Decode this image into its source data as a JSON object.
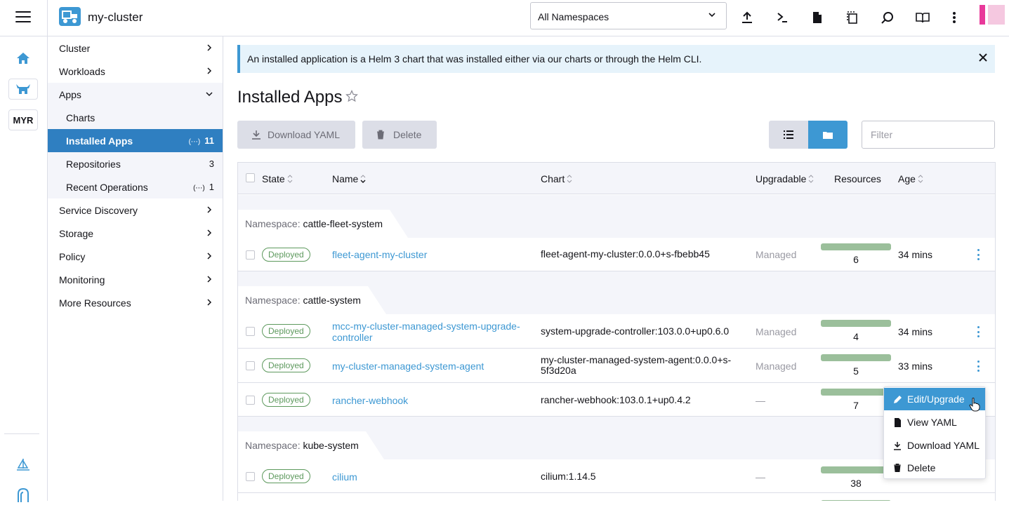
{
  "header": {
    "cluster_name": "my-cluster",
    "namespace_selected": "All Namespaces",
    "actions": [
      "import-yaml",
      "kubectl-shell",
      "kubeconfig-download",
      "copy-kubeconfig",
      "resource-search",
      "docs",
      "more"
    ]
  },
  "rail": {
    "cluster_badge": "MYR"
  },
  "sidebar": {
    "items": [
      {
        "label": "Cluster"
      },
      {
        "label": "Workloads"
      },
      {
        "label": "Apps"
      },
      {
        "label": "Charts"
      },
      {
        "label": "Installed Apps",
        "count": "11"
      },
      {
        "label": "Repositories",
        "count": "3"
      },
      {
        "label": "Recent Operations",
        "count": "1"
      },
      {
        "label": "Service Discovery"
      },
      {
        "label": "Storage"
      },
      {
        "label": "Policy"
      },
      {
        "label": "Monitoring"
      },
      {
        "label": "More Resources"
      }
    ]
  },
  "banner": {
    "text": "An installed application is a Helm 3 chart that was installed either via our charts or through the Helm CLI."
  },
  "page": {
    "title": "Installed Apps",
    "download_yaml": "Download YAML",
    "delete": "Delete",
    "filter_placeholder": "Filter"
  },
  "table": {
    "columns": [
      "State",
      "Name",
      "Chart",
      "Upgradable",
      "Resources",
      "Age"
    ],
    "namespace_label": "Namespace:",
    "groups": [
      {
        "namespace": "cattle-fleet-system",
        "rows": [
          {
            "state": "Deployed",
            "name": "fleet-agent-my-cluster",
            "chart": "fleet-agent-my-cluster:0.0.0+s-fbebb45",
            "upgradable": "Managed",
            "resources": "6",
            "age": "34 mins"
          }
        ]
      },
      {
        "namespace": "cattle-system",
        "rows": [
          {
            "state": "Deployed",
            "name_line1": "mcc-my-cluster-managed-system-upgrade-",
            "name_line2": "controller",
            "chart": "system-upgrade-controller:103.0.0+up0.6.0",
            "upgradable": "Managed",
            "resources": "4",
            "age": "34 mins"
          },
          {
            "state": "Deployed",
            "name": "my-cluster-managed-system-agent",
            "chart_line1": "my-cluster-managed-system-agent:0.0.0+s-",
            "chart_line2": "5f3d20a",
            "upgradable": "Managed",
            "resources": "5",
            "age": "33 mins"
          },
          {
            "state": "Deployed",
            "name": "rancher-webhook",
            "chart": "rancher-webhook:103.0.1+up0.4.2",
            "upgradable": "—",
            "resources": "7",
            "age": ""
          }
        ]
      },
      {
        "namespace": "kube-system",
        "rows": [
          {
            "state": "Deployed",
            "name": "cilium",
            "chart": "cilium:1.14.5",
            "upgradable": "—",
            "resources": "38",
            "age": ""
          }
        ]
      }
    ]
  },
  "action_menu": {
    "items": [
      "Edit/Upgrade",
      "View YAML",
      "Download YAML",
      "Delete"
    ]
  },
  "colors": {
    "accent": "#3d98d3",
    "active_nav": "#2f7fc1",
    "deployed": "#5d995d",
    "resource_bar": "#9bbf9b"
  }
}
